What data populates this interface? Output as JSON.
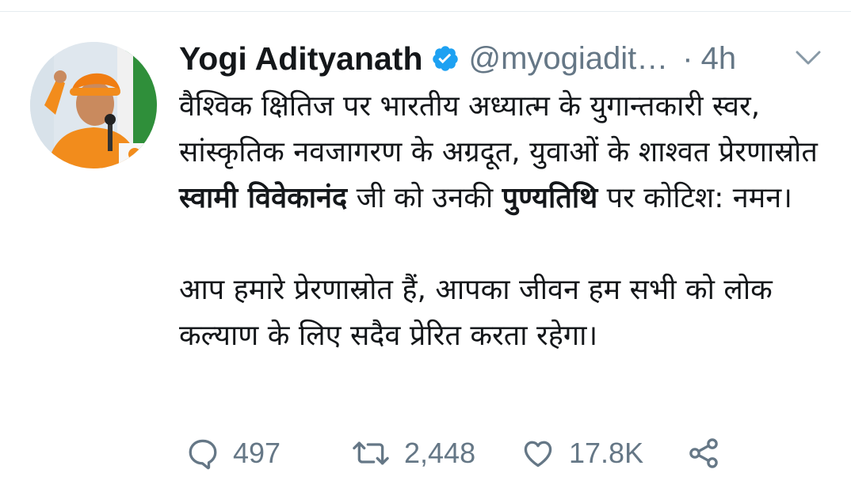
{
  "tweet": {
    "author_name": "Yogi Adityanath",
    "handle": "@myogiadit…",
    "separator": "·",
    "time": "4h",
    "para1_a": "वैश्विक क्षितिज पर भारतीय अध्यात्म के युगान्तकारी स्वर, सांस्कृतिक नवजागरण के अग्रदूत, युवाओं के शाश्वत प्रेरणास्रोत ",
    "para1_bold1": "स्वामी विवेकानंद",
    "para1_b": " जी को उनकी ",
    "para1_bold2": "पुण्यतिथि",
    "para1_c": " पर कोटिश: नमन।",
    "para2": "आप हमारे प्रेरणास्रोत हैं, आपका जीवन हम सभी को लोक कल्याण के लिए सदैव प्रेरित करता रहेगा।"
  },
  "actions": {
    "reply_count": "497",
    "retweet_count": "2,448",
    "like_count": "17.8K"
  },
  "icons": {
    "verified": "verified-badge-icon",
    "chevron": "chevron-down-icon",
    "reply": "reply-icon",
    "retweet": "retweet-icon",
    "like": "heart-icon",
    "share": "share-icon"
  },
  "colors": {
    "verified_blue": "#1da1f2",
    "secondary_text": "#657786",
    "primary_text": "#14171a",
    "saffron": "#f28c1c"
  }
}
